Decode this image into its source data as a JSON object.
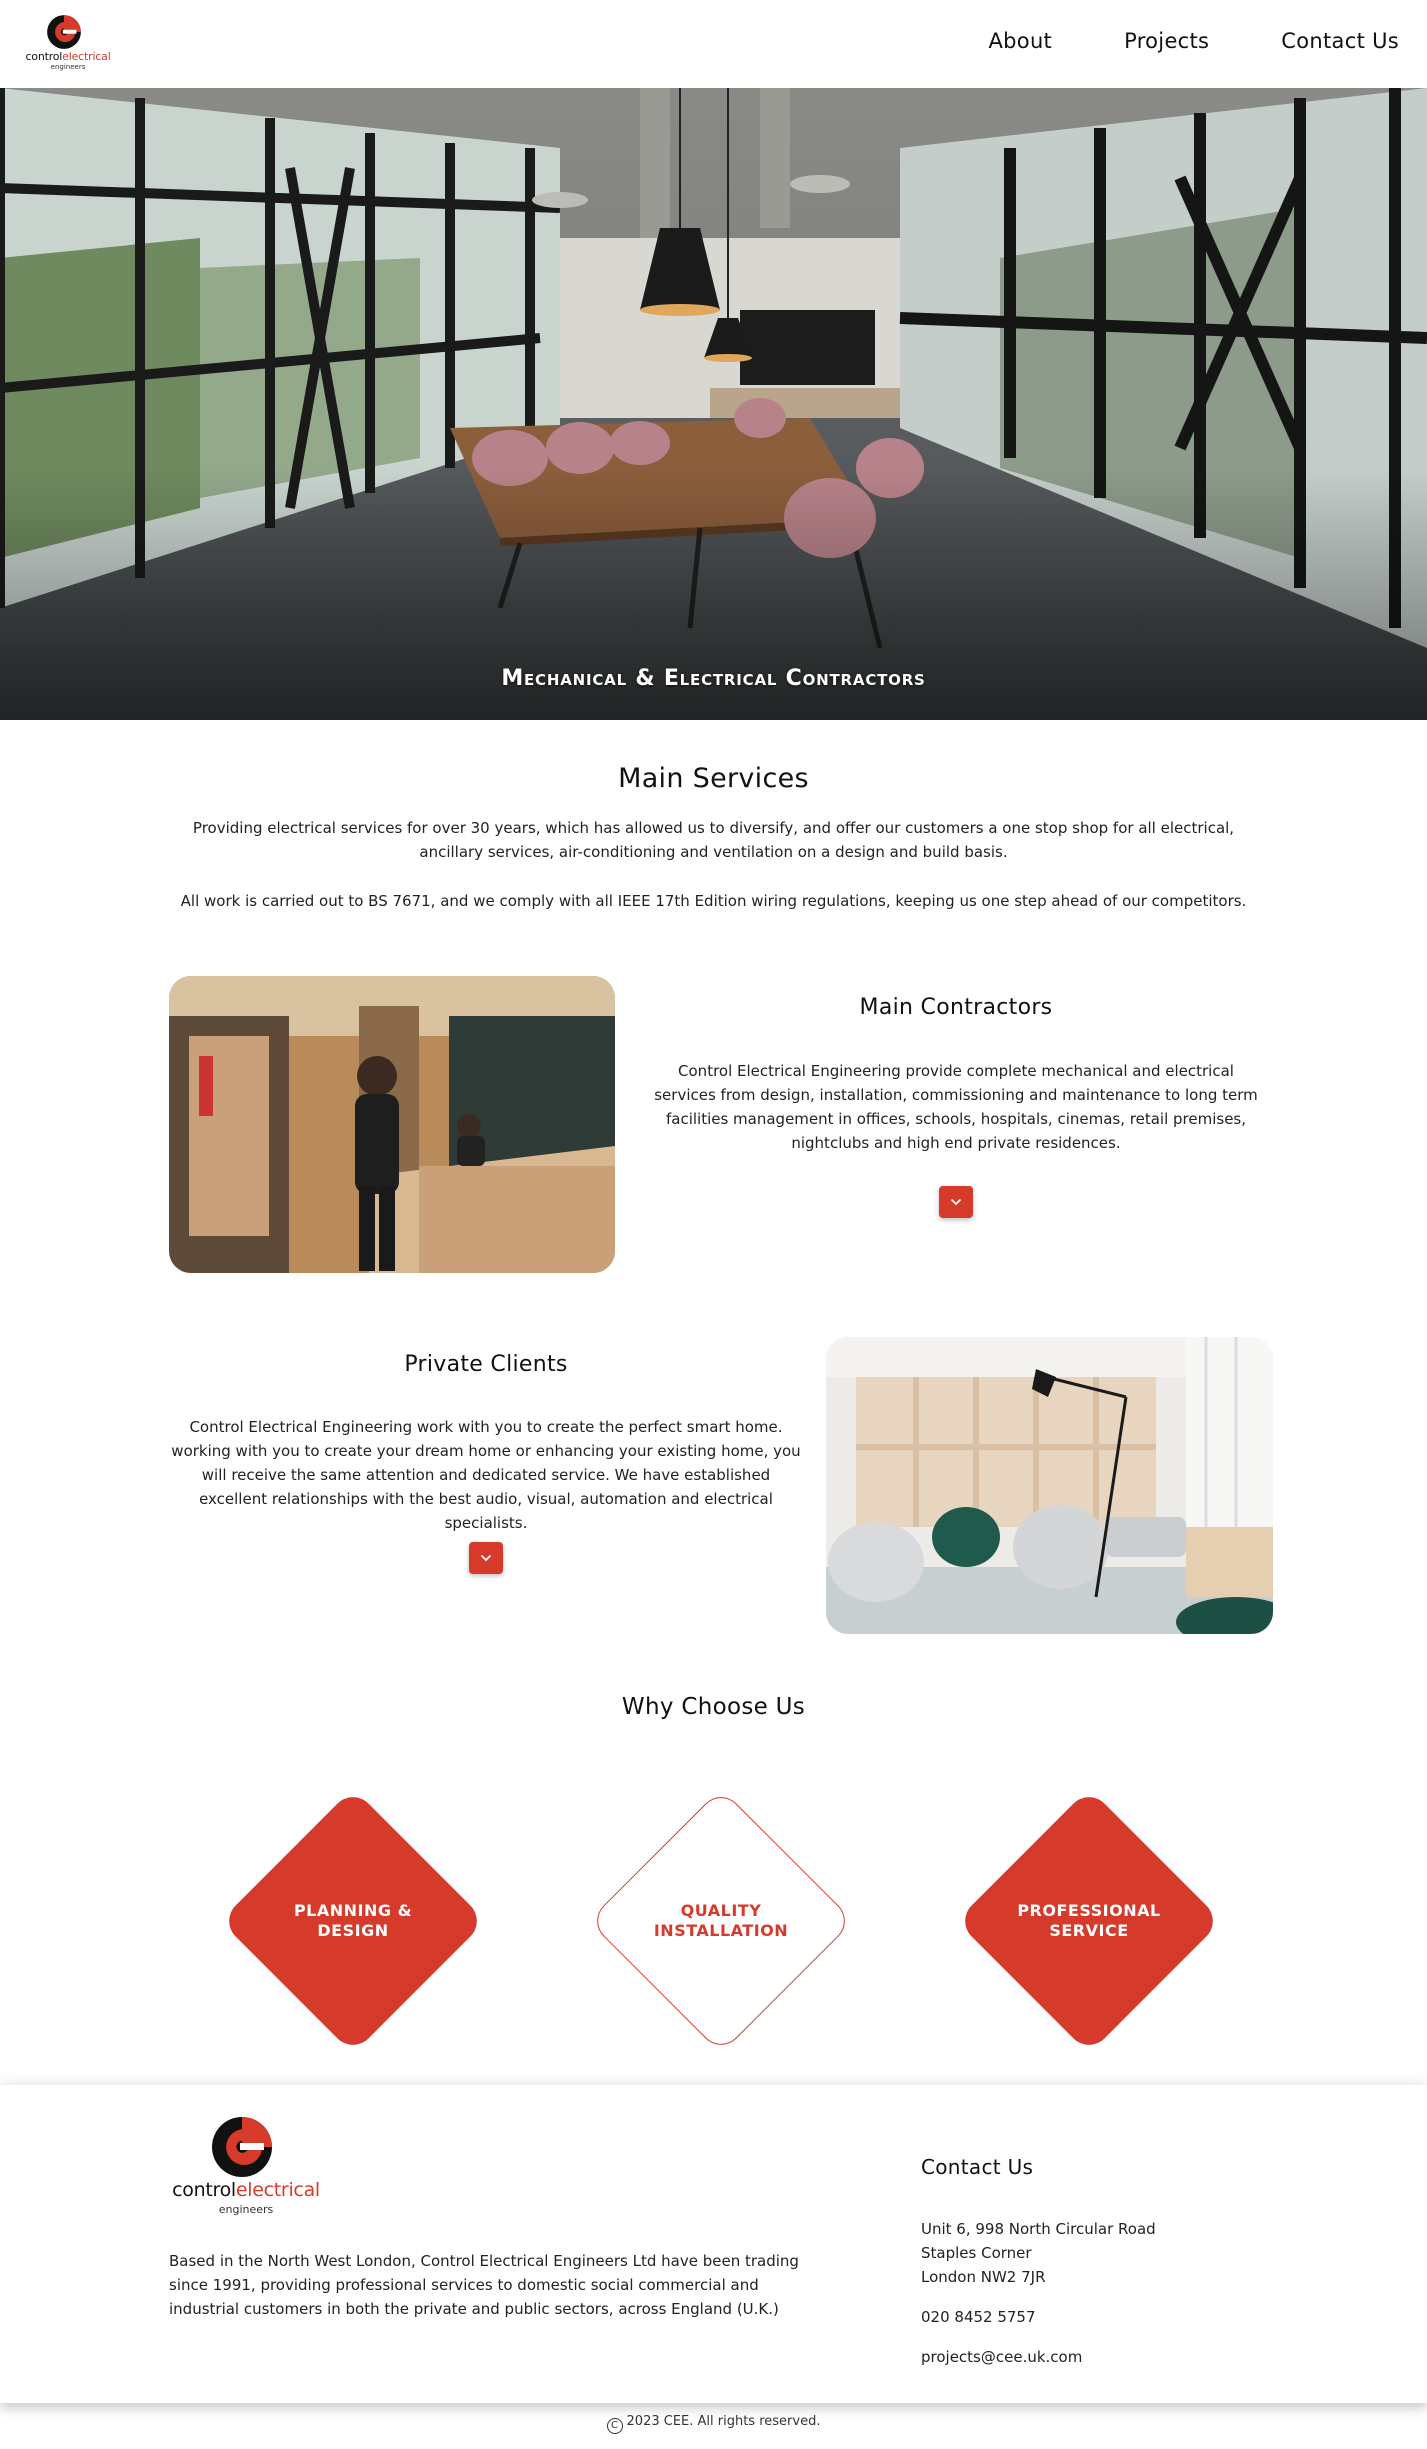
{
  "brand": {
    "name_part1": "control",
    "name_part2": "electrical",
    "tagline": "engineers",
    "accent_color": "#d63a2a"
  },
  "nav": {
    "items": [
      {
        "label": "About"
      },
      {
        "label": "Projects"
      },
      {
        "label": "Contact Us"
      }
    ]
  },
  "hero": {
    "title": "Mechanical & Electrical Contractors"
  },
  "main_services": {
    "title": "Main Services",
    "paragraph1": "Providing electrical services for over 30 years, which has allowed us to diversify, and offer our customers a one stop shop for all electrical, ancillary services, air-conditioning and ventilation on a design and build basis.",
    "paragraph2": "All work is carried out to BS 7671, and we comply with all IEEE 17th Edition wiring regulations, keeping us one step ahead of our competitors."
  },
  "main_contractors": {
    "title": "Main Contractors",
    "text": "Control Electrical Engineering provide complete mechanical and electrical services from design, installation, commissioning and maintenance to long term facilities management in offices, schools, hospitals, cinemas, retail premises, nightclubs and high end private residences.",
    "expand_icon": "chevron-down-icon"
  },
  "private_clients": {
    "title": "Private Clients",
    "text": "Control Electrical Engineering work with you to create the perfect smart home. working with you to create your dream home or enhancing your existing home, you will receive the same attention and dedicated service. We have established excellent relationships with the best audio, visual, automation and electrical specialists.",
    "expand_icon": "chevron-down-icon"
  },
  "why_choose_us": {
    "title": "Why Choose Us",
    "items": [
      {
        "line1": "PLANNING &",
        "line2": "DESIGN",
        "style": "filled"
      },
      {
        "line1": "QUALITY",
        "line2": "INSTALLATION",
        "style": "outline"
      },
      {
        "line1": "PROFESSIONAL",
        "line2": "SERVICE",
        "style": "filled"
      }
    ]
  },
  "footer": {
    "about": "Based in the North West London, Control Electrical Engineers Ltd have been trading since 1991, providing professional services to domestic social commercial and industrial customers in both the private and public sectors, across England (U.K.)",
    "contact_title": "Contact Us",
    "address_line1": "Unit 6, 998 North Circular Road",
    "address_line2": "Staples Corner",
    "address_line3": "London NW2 7JR",
    "phone": "020 8452 5757",
    "email": "projects@cee.uk.com",
    "copyright": "2023 CEE. All rights reserved."
  }
}
